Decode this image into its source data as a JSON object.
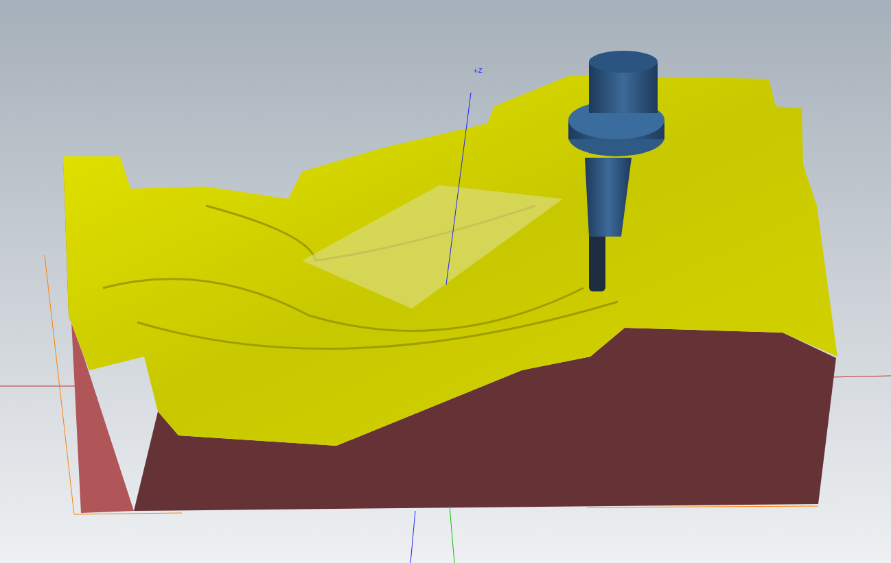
{
  "viewport": {
    "axis_label": "+Z"
  }
}
